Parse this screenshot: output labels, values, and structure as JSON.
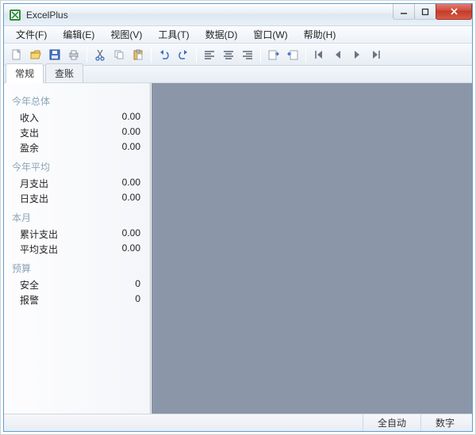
{
  "window": {
    "title": "ExcelPlus"
  },
  "menu": {
    "file": "文件(F)",
    "edit": "编辑(E)",
    "view": "视图(V)",
    "tools": "工具(T)",
    "data": "数据(D)",
    "window": "窗口(W)",
    "help": "帮助(H)"
  },
  "tabs": {
    "general": "常规",
    "chazhang": "查账"
  },
  "panel": {
    "sections": {
      "year_total": {
        "title": "今年总体",
        "rows": [
          {
            "label": "收入",
            "value": "0.00"
          },
          {
            "label": "支出",
            "value": "0.00"
          },
          {
            "label": "盈余",
            "value": "0.00"
          }
        ]
      },
      "year_avg": {
        "title": "今年平均",
        "rows": [
          {
            "label": "月支出",
            "value": "0.00"
          },
          {
            "label": "日支出",
            "value": "0.00"
          }
        ]
      },
      "this_month": {
        "title": "本月",
        "rows": [
          {
            "label": "累计支出",
            "value": "0.00"
          },
          {
            "label": "平均支出",
            "value": "0.00"
          }
        ]
      },
      "budget": {
        "title": "预算",
        "rows": [
          {
            "label": "安全",
            "value": "0"
          },
          {
            "label": "报警",
            "value": "0"
          }
        ]
      }
    }
  },
  "status": {
    "auto": "全自动",
    "num": "数字"
  }
}
